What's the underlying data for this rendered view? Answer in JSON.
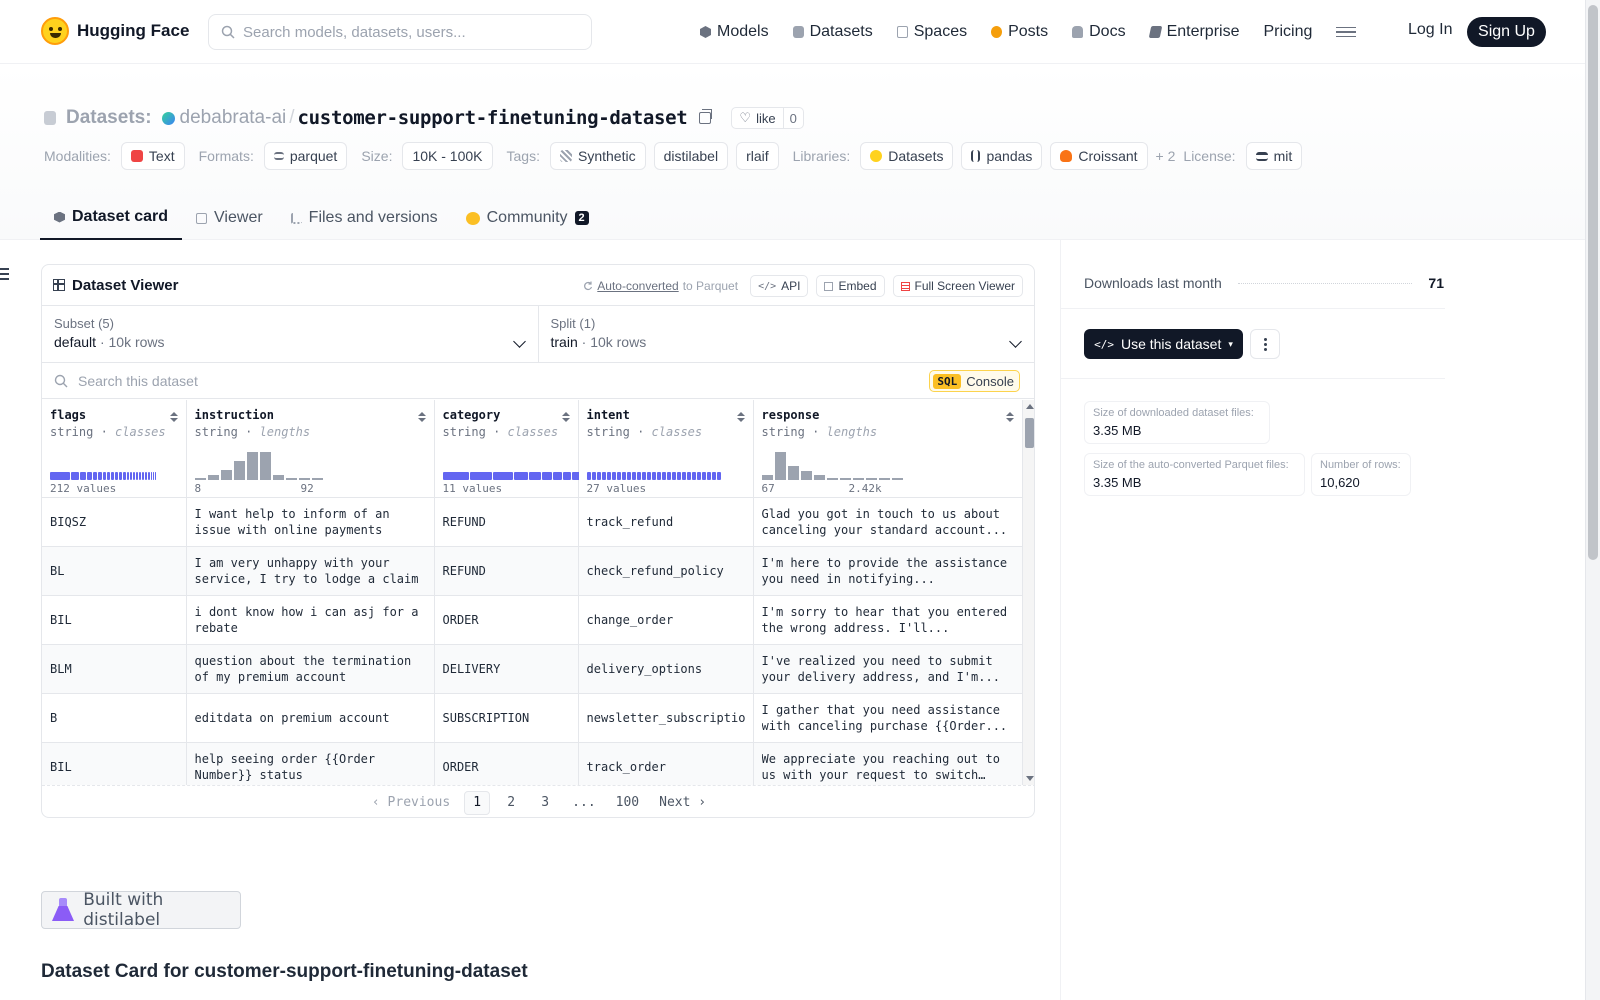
{
  "nav": {
    "logo_text": "Hugging Face",
    "search_placeholder": "Search models, datasets, users...",
    "links": [
      "Models",
      "Datasets",
      "Spaces",
      "Posts",
      "Docs",
      "Enterprise",
      "Pricing"
    ],
    "login": "Log In",
    "signup": "Sign Up"
  },
  "header": {
    "section": "Datasets:",
    "user": "debabrata-ai",
    "slash": "/",
    "name": "customer-support-finetuning-dataset",
    "like_label": "like",
    "like_count": "0",
    "modalities_label": "Modalities:",
    "modality": "Text",
    "formats_label": "Formats:",
    "format": "parquet",
    "size_label": "Size:",
    "size": "10K - 100K",
    "tags_label": "Tags:",
    "tags": [
      "Synthetic",
      "distilabel",
      "rlaif"
    ],
    "libraries_label": "Libraries:",
    "libraries": [
      "Datasets",
      "pandas",
      "Croissant"
    ],
    "more": "+ 2",
    "license_label": "License:",
    "license": "mit"
  },
  "tabs": [
    {
      "label": "Dataset card"
    },
    {
      "label": "Viewer"
    },
    {
      "label": "Files and versions"
    },
    {
      "label": "Community",
      "badge": "2"
    }
  ],
  "viewer": {
    "title": "Dataset Viewer",
    "auto_converted": "Auto-converted",
    "to_parquet": "to Parquet",
    "api": "API",
    "embed": "Embed",
    "fullscreen": "Full Screen Viewer",
    "subset_label": "Subset (5)",
    "subset_value": "default",
    "subset_rows": "10k rows",
    "split_label": "Split (1)",
    "split_value": "train",
    "split_rows": "10k rows",
    "search_placeholder": "Search this dataset",
    "sql": "SQL",
    "console": "Console",
    "columns": [
      {
        "name": "flags",
        "type": "string",
        "kind": "classes",
        "stat": "212 values"
      },
      {
        "name": "instruction",
        "type": "string",
        "kind": "lengths",
        "min": "8",
        "max": "92"
      },
      {
        "name": "category",
        "type": "string",
        "kind": "classes",
        "stat": "11 values"
      },
      {
        "name": "intent",
        "type": "string",
        "kind": "classes",
        "stat": "27 values"
      },
      {
        "name": "response",
        "type": "string",
        "kind": "lengths",
        "min": "67",
        "max": "2.42k"
      }
    ],
    "rows": [
      [
        "BIQSZ",
        "I want help to inform of an issue with online payments",
        "REFUND",
        "track_refund",
        "Glad you got in touch to us about canceling your standard account..."
      ],
      [
        "BL",
        "I am very unhappy with your service, I try to lodge a claim",
        "REFUND",
        "check_refund_policy",
        "I'm here to provide the assistance you need in notifying..."
      ],
      [
        "BIL",
        "i dont know how i can asj for a rebate",
        "ORDER",
        "change_order",
        "I'm sorry to hear that you entered the wrong address. I'll..."
      ],
      [
        "BLM",
        "question about the termination of my premium account",
        "DELIVERY",
        "delivery_options",
        "I've realized you need to submit your delivery address, and I'm..."
      ],
      [
        "B",
        "editdata on premium account",
        "SUBSCRIPTION",
        "newsletter_subscription",
        "I gather that you need assistance with canceling purchase {{Order..."
      ],
      [
        "BIL",
        "help seeing order {{Order Number}} status",
        "ORDER",
        "track_order",
        "We appreciate you reaching out to us with your request to switch a..."
      ]
    ],
    "pager": {
      "prev": "Previous",
      "pages": [
        "1",
        "2",
        "3",
        "...",
        "100"
      ],
      "next": "Next"
    }
  },
  "built_with": "Built with distilabel",
  "card_heading": "Dataset Card for customer-support-finetuning-dataset",
  "sidebar": {
    "downloads_label": "Downloads last month",
    "downloads_value": "71",
    "use_dataset": "Use this dataset",
    "size_dl_label": "Size of downloaded dataset files:",
    "size_dl_value": "3.35 MB",
    "size_parquet_label": "Size of the auto-converted Parquet files:",
    "size_parquet_value": "3.35 MB",
    "rows_label": "Number of rows:",
    "rows_value": "10,620"
  }
}
